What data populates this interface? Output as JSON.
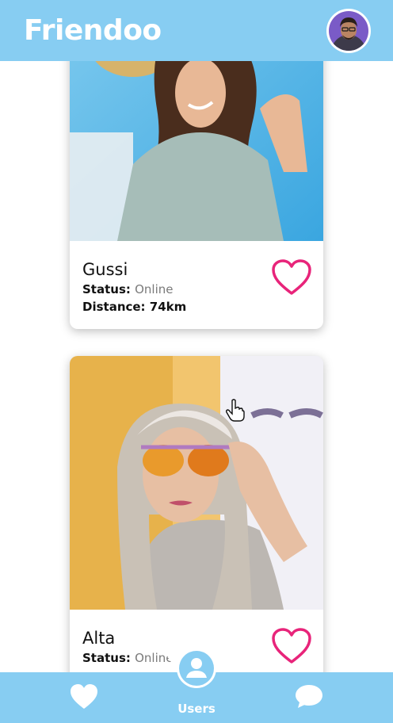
{
  "header": {
    "title": "Friendoo",
    "avatar_icon": "user-avatar"
  },
  "users": [
    {
      "name": "Gussi",
      "status_label": "Status:",
      "status_value": "Online",
      "distance_label": "Distance:",
      "distance_value": "74km"
    },
    {
      "name": "Alta",
      "status_label": "Status:",
      "status_value": "Online"
    }
  ],
  "nav": {
    "left_icon": "heart-icon",
    "center_label": "Users",
    "center_icon": "user-icon",
    "right_icon": "chat-icon"
  },
  "colors": {
    "primary": "#87cdf2",
    "like": "#e8247a",
    "status_online": "#7a7a7a"
  }
}
